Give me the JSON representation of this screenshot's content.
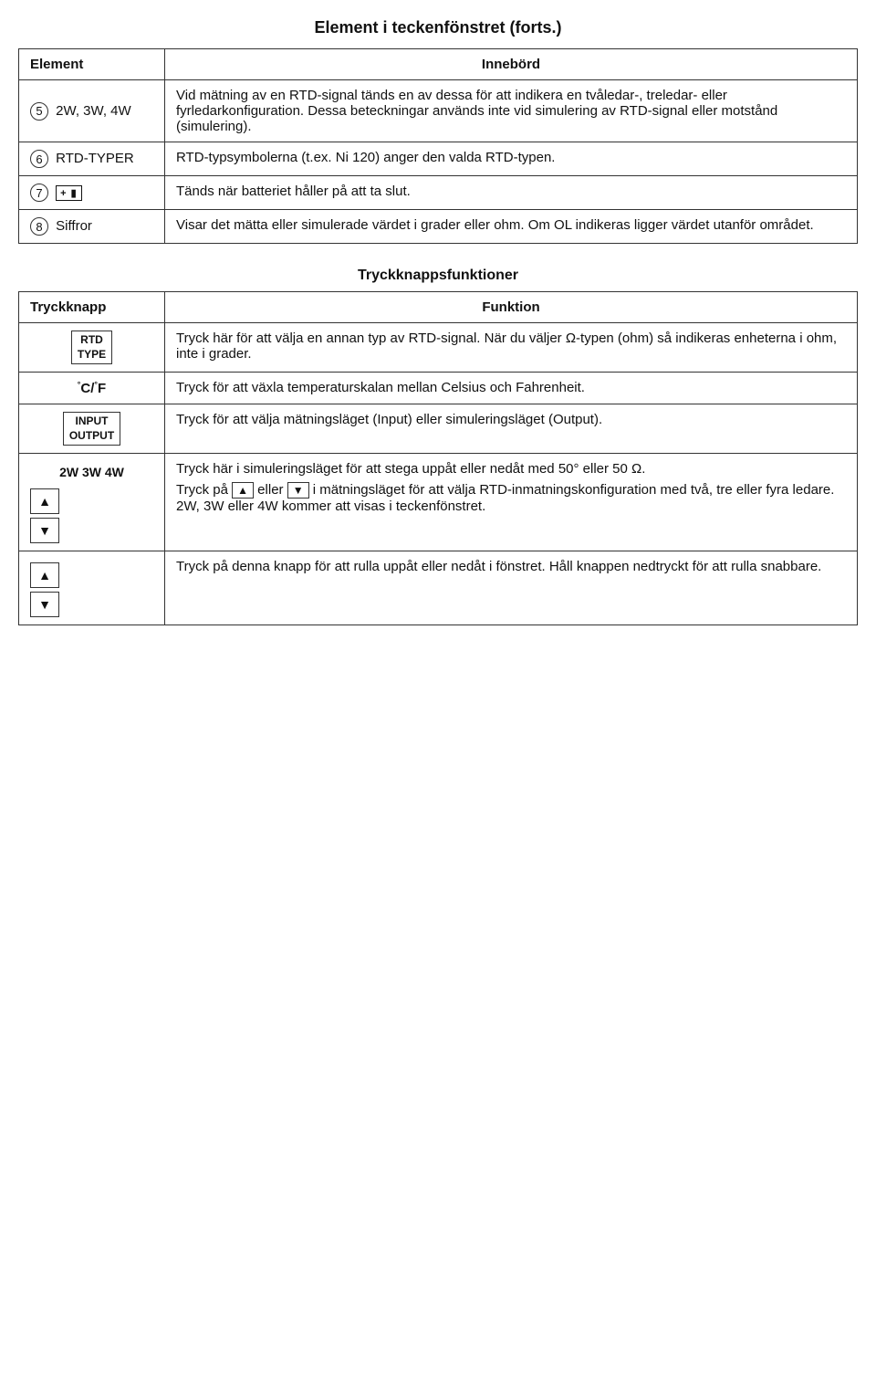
{
  "page": {
    "title": "Element i teckenfönstret (forts.)"
  },
  "top_table": {
    "col1_header": "Element",
    "col2_header": "Innebörd",
    "rows": [
      {
        "num": "5",
        "element": "2W, 3W, 4W",
        "content": "Vid mätning av en RTD-signal tänds en av dessa för att indikera en tvåledar-, treledar- eller fyrledarkonfiguration. Dessa beteckningar används inte vid simulering av RTD-signal eller motstånd (simulering)."
      },
      {
        "num": "6",
        "element": "RTD-TYPER",
        "content": "RTD-typsymbolerna (t.ex. Ni 120) anger den valda RTD-typen."
      },
      {
        "num": "7",
        "element": "battery",
        "content": "Tänds när batteriet håller på att ta slut."
      },
      {
        "num": "8",
        "element": "Siffror",
        "content": "Visar det mätta eller simulerade värdet i grader eller ohm. Om OL indikeras ligger värdet utanför området."
      }
    ]
  },
  "bottom_table": {
    "section_header": "Tryckknappsfunktioner",
    "col1_header": "Tryckknapp",
    "col2_header": "Funktion",
    "rows": [
      {
        "key": "rtd_type",
        "btn_line1": "RTD",
        "btn_line2": "TYPE",
        "func": "Tryck här för att välja en annan typ av RTD-signal. När du väljer Ω-typen (ohm) så indikeras enheterna i ohm, inte i grader."
      },
      {
        "key": "cf",
        "btn_text": "°C/°F",
        "func": "Tryck för att växla temperaturskalan mellan Celsius och Fahrenheit."
      },
      {
        "key": "input_output",
        "btn_line1": "INPUT",
        "btn_line2": "OUTPUT",
        "func": "Tryck för att välja mätningsläget (Input) eller simuleringsläget (Output)."
      },
      {
        "key": "2w3w4w_arrows",
        "btn_text": "2W 3W 4W",
        "func1": "Tryck här i simuleringsläget för att stega uppåt eller nedåt med 50° eller 50 Ω.",
        "func2": "Tryck på ▲ eller ▼ i mätningsläget för att välja RTD-inmatningskonfiguration med två, tre eller fyra ledare. 2W, 3W eller 4W kommer att visas i teckenfönstret."
      },
      {
        "key": "scroll_arrows",
        "func": "Tryck på denna knapp för att rulla uppåt eller nedåt i fönstret. Håll knappen nedtryckt för att rulla snabbare."
      }
    ]
  }
}
